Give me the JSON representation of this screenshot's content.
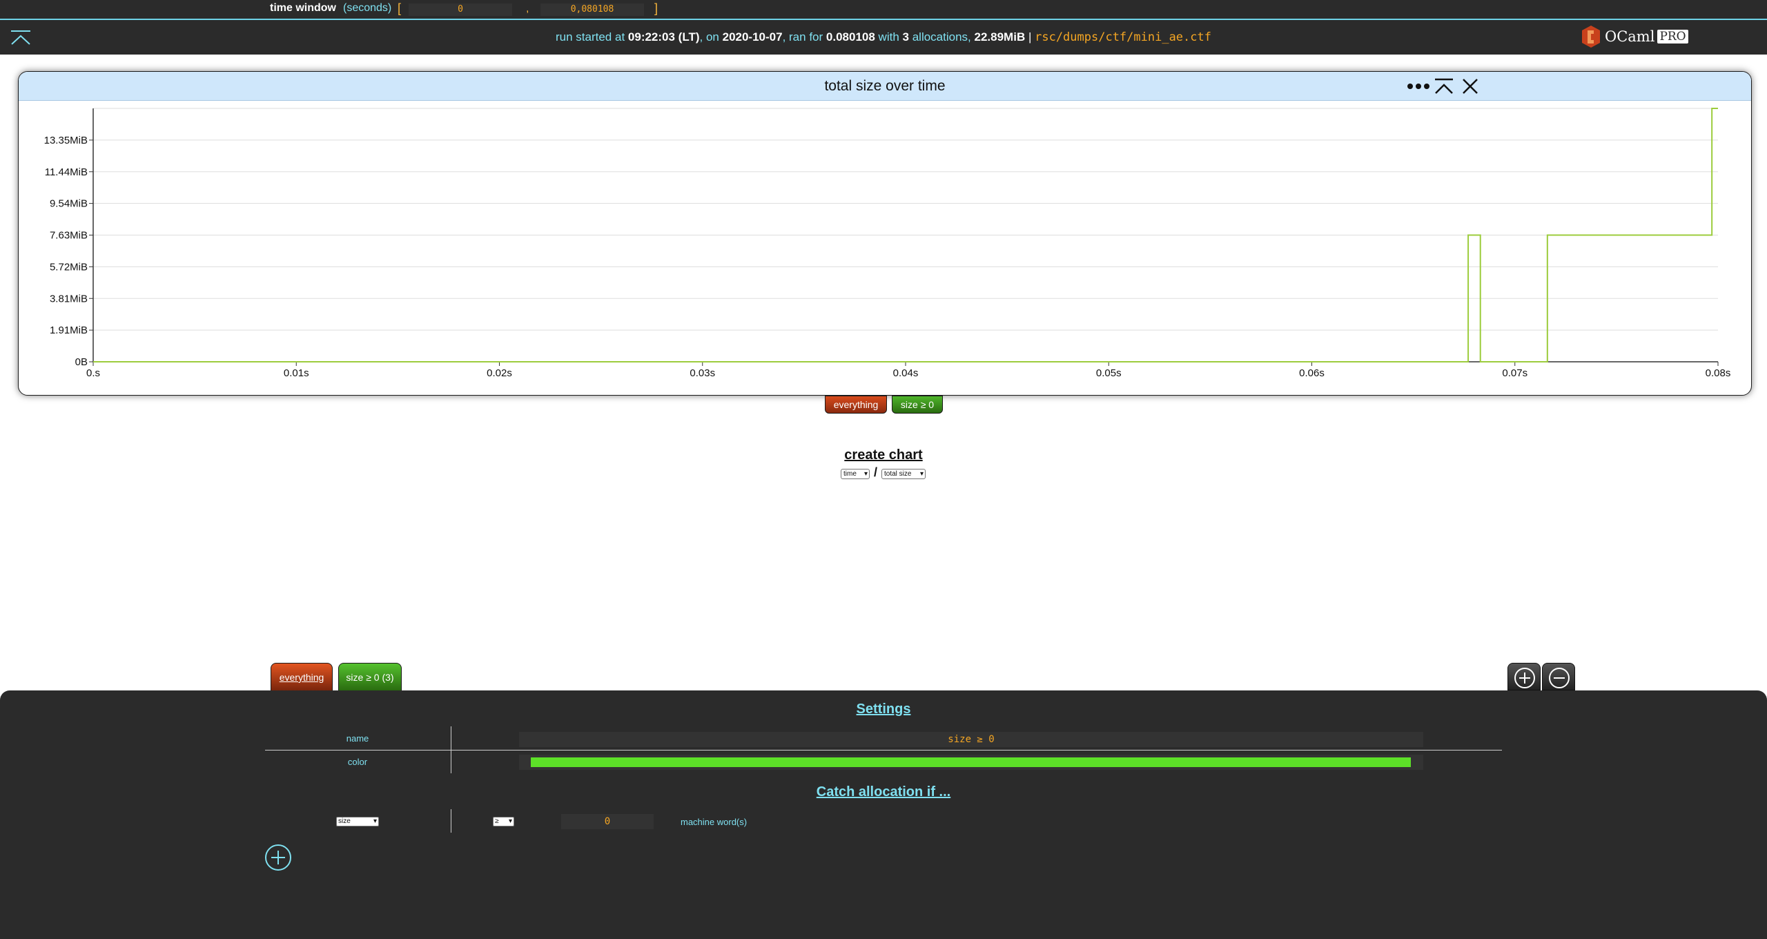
{
  "topbar": {
    "time_window_label": "time window",
    "time_window_unit": "(seconds)",
    "open_bracket": "[",
    "close_bracket": "]",
    "comma": ",",
    "start_value": "0",
    "end_value": "0,080108",
    "run_info": {
      "prefix": "run started at",
      "time": "09:22:03 (LT)",
      "on": ", on",
      "date": "2020-10-07",
      "ran_for": ", ran for",
      "duration": "0.080108",
      "with": "with",
      "alloc_count": "3",
      "allocations": "allocations,",
      "size": "22.89MiB",
      "sep": "|",
      "path": "rsc/dumps/ctf/mini_ae.ctf"
    },
    "logo_text": "OCaml",
    "logo_pro": "PRO"
  },
  "chart": {
    "title": "total size over time",
    "legend": [
      "everything",
      "size ≥ 0"
    ]
  },
  "chart_data": {
    "type": "line",
    "title": "total size over time",
    "xlabel": "",
    "ylabel": "",
    "x_ticks": [
      "0.s",
      "0.01s",
      "0.02s",
      "0.03s",
      "0.04s",
      "0.05s",
      "0.06s",
      "0.07s",
      "0.08s"
    ],
    "y_ticks": [
      "0B",
      "1.91MiB",
      "3.81MiB",
      "5.72MiB",
      "7.63MiB",
      "9.54MiB",
      "11.44MiB",
      "13.35MiB"
    ],
    "xlim": [
      0,
      0.08
    ],
    "ylim": [
      0,
      15.26
    ],
    "grid": true,
    "series": [
      {
        "name": "size ≥ 0",
        "color": "#9ccc3c",
        "step": true,
        "x": [
          0,
          0.0677,
          0.0683,
          0.0716,
          0.0797,
          0.08
        ],
        "y": [
          0,
          7.63,
          0,
          7.63,
          15.26,
          15.26
        ]
      }
    ]
  },
  "create_chart": {
    "label": "create chart",
    "x_select": "time",
    "slash": "/",
    "y_select": "total size"
  },
  "tabs": {
    "everything": "everything",
    "size": "size ≥ 0 (3)"
  },
  "settings": {
    "title": "Settings",
    "name_label": "name",
    "name_value": "size ≥ 0",
    "color_label": "color",
    "color_value": "#5de028",
    "catch_title": "Catch allocation if ...",
    "cond_field": "size",
    "cond_op": "≥",
    "cond_value": "0",
    "cond_unit": "machine word(s)"
  },
  "colors": {
    "accent": "#7fe0f0",
    "value": "#f5a623",
    "everything": "#d84b1c",
    "size_filter": "#4fb52b",
    "panel_bg": "#2b2b2b"
  },
  "icons": {
    "fold": "chevron-up-bar-icon",
    "more": "more-dots-icon",
    "collapse": "collapse-up-icon",
    "close": "close-icon",
    "zoom_in": "plus-circle-icon",
    "zoom_out": "minus-circle-icon",
    "add": "plus-circle-icon"
  }
}
